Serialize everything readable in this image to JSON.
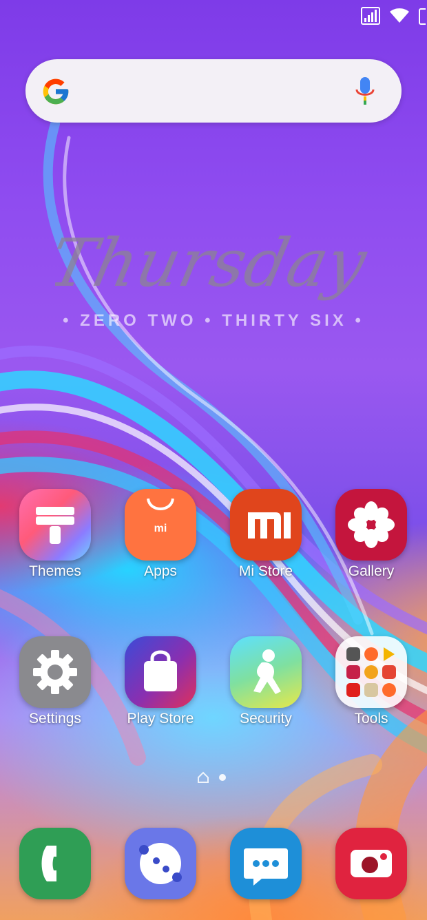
{
  "status_bar": {
    "icons": [
      "signal-icon",
      "wifi-icon",
      "battery-icon"
    ]
  },
  "search": {
    "logo": "google-g-icon",
    "voice_icon": "microphone-icon"
  },
  "clock_widget": {
    "day": "Thursday",
    "time": "• ZERO TWO • THIRTY SIX •"
  },
  "apps_row1": [
    {
      "label": "Themes",
      "icon": "themes-icon"
    },
    {
      "label": "Apps",
      "icon": "apps-icon"
    },
    {
      "label": "Mi Store",
      "icon": "mi-store-icon"
    },
    {
      "label": "Gallery",
      "icon": "gallery-icon"
    }
  ],
  "apps_row2": [
    {
      "label": "Settings",
      "icon": "settings-icon"
    },
    {
      "label": "Play Store",
      "icon": "play-store-icon"
    },
    {
      "label": "Security",
      "icon": "security-icon"
    },
    {
      "label": "Tools",
      "icon": "tools-folder-icon"
    }
  ],
  "page_indicator": {
    "pages": 2,
    "current": 1
  },
  "dock": [
    {
      "icon": "phone-icon"
    },
    {
      "icon": "browser-icon"
    },
    {
      "icon": "messages-icon"
    },
    {
      "icon": "camera-icon"
    }
  ]
}
